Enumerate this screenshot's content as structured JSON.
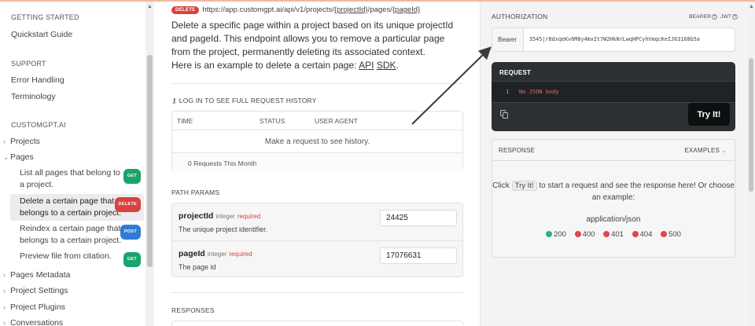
{
  "sidebar": {
    "getting_started": "GETTING STARTED",
    "quickstart": "Quickstart Guide",
    "support": "SUPPORT",
    "error_handling": "Error Handling",
    "terminology": "Terminology",
    "customgpt": "CUSTOMGPT.AI",
    "projects": "Projects",
    "pages": "Pages",
    "page_items": [
      {
        "label_1": "List all pages that belong to",
        "label_2": "a project.",
        "method": "GET"
      },
      {
        "label_1": "Delete a certain page that",
        "label_2": "belongs to a certain project.",
        "method": "DELETE"
      },
      {
        "label_1": "Reindex a certain page that",
        "label_2": "belongs to a certain project.",
        "method": "POST"
      },
      {
        "label_1": "Preview file from citation.",
        "label_2": "",
        "method": "GET"
      }
    ],
    "pages_metadata": "Pages Metadata",
    "project_settings": "Project Settings",
    "project_plugins": "Project Plugins",
    "conversations": "Conversations"
  },
  "endpoint": {
    "method": "DELETE",
    "url_prefix": "https://app.customgpt.ai/api/v1/projects/",
    "url_project": "{projectId}",
    "url_mid": "/pages/",
    "url_page": "{pageId}",
    "description": "Delete a specific page within a project based on its unique projectId and pageId. This endpoint allows you to remove a particular page from the project, permanently deleting its associated context.",
    "example_prefix": "Here is an example to delete a certain page: ",
    "api_link": "API",
    "sdk_link": "SDK",
    "example_suffix": "."
  },
  "history": {
    "header": "LOG IN TO SEE FULL REQUEST HISTORY",
    "col_time": "TIME",
    "col_status": "STATUS",
    "col_agent": "USER AGENT",
    "empty": "Make a request to see history.",
    "count": "0 Requests This Month"
  },
  "path_params": {
    "header": "PATH PARAMS",
    "params": [
      {
        "name": "projectId",
        "type": "integer",
        "required": "required",
        "desc": "The unique project identifier.",
        "value": "24425"
      },
      {
        "name": "pageId",
        "type": "integer",
        "required": "required",
        "desc": "The page id",
        "value": "17076631"
      }
    ]
  },
  "responses_header": "RESPONSES",
  "auth": {
    "header": "AUTHORIZATION",
    "opt_bearer": "BEARER",
    "opt_jwt": "JWT",
    "label": "Bearer",
    "token": "3545|r8dxqeKv6M8y4mxIt7W2HkNrLwqHPCyhVmqcKeIJ63168b5a"
  },
  "request": {
    "header": "REQUEST",
    "line_no": "1",
    "body": "No JSON body",
    "try_label": "Try It!"
  },
  "response": {
    "header": "RESPONSE",
    "examples": "EXAMPLES",
    "msg_before": "Click ",
    "msg_try": "Try It!",
    "msg_after": " to start a request and see the response here! Or choose an example:",
    "mime": "application/json",
    "codes": [
      {
        "code": "200",
        "color": "#27b57a"
      },
      {
        "code": "400",
        "color": "#e0464a"
      },
      {
        "code": "401",
        "color": "#e0464a"
      },
      {
        "code": "404",
        "color": "#e0464a"
      },
      {
        "code": "500",
        "color": "#e0464a"
      }
    ]
  }
}
